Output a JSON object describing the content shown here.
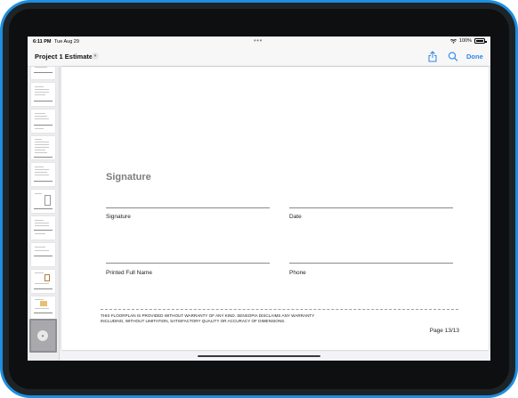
{
  "status_bar": {
    "time": "6:11 PM",
    "date": "Tue Aug 29",
    "battery_text": "100%",
    "battery_level": 1.0
  },
  "nav": {
    "title": "Project 1 Estimate",
    "done_label": "Done",
    "accent_color": "#2a86e8",
    "icons": [
      "chevron-down-icon",
      "share-icon",
      "search-icon"
    ]
  },
  "page": {
    "heading": "Signature",
    "fields": {
      "signature": "Signature",
      "date": "Date",
      "printed_name": "Printed Full Name",
      "phone": "Phone"
    },
    "disclaimer_line1": "THIS FLOORPLAN IS PROVIDED WITHOUT WARRANTY OF ANY KIND. SENSOPIA DISCLAIMS ANY WARRANTY",
    "disclaimer_line2": "INCLUDING, WITHOUT LIMITATION, SATISFACTORY QUALITY OR ACCURACY OF DIMENSIONS.",
    "page_number": "Page 13/13"
  },
  "thumbnails": {
    "count": 13,
    "current_index": 12
  },
  "colors": {
    "device_edge": "#1d8fe0",
    "heading_gray": "#7d7d7d"
  }
}
